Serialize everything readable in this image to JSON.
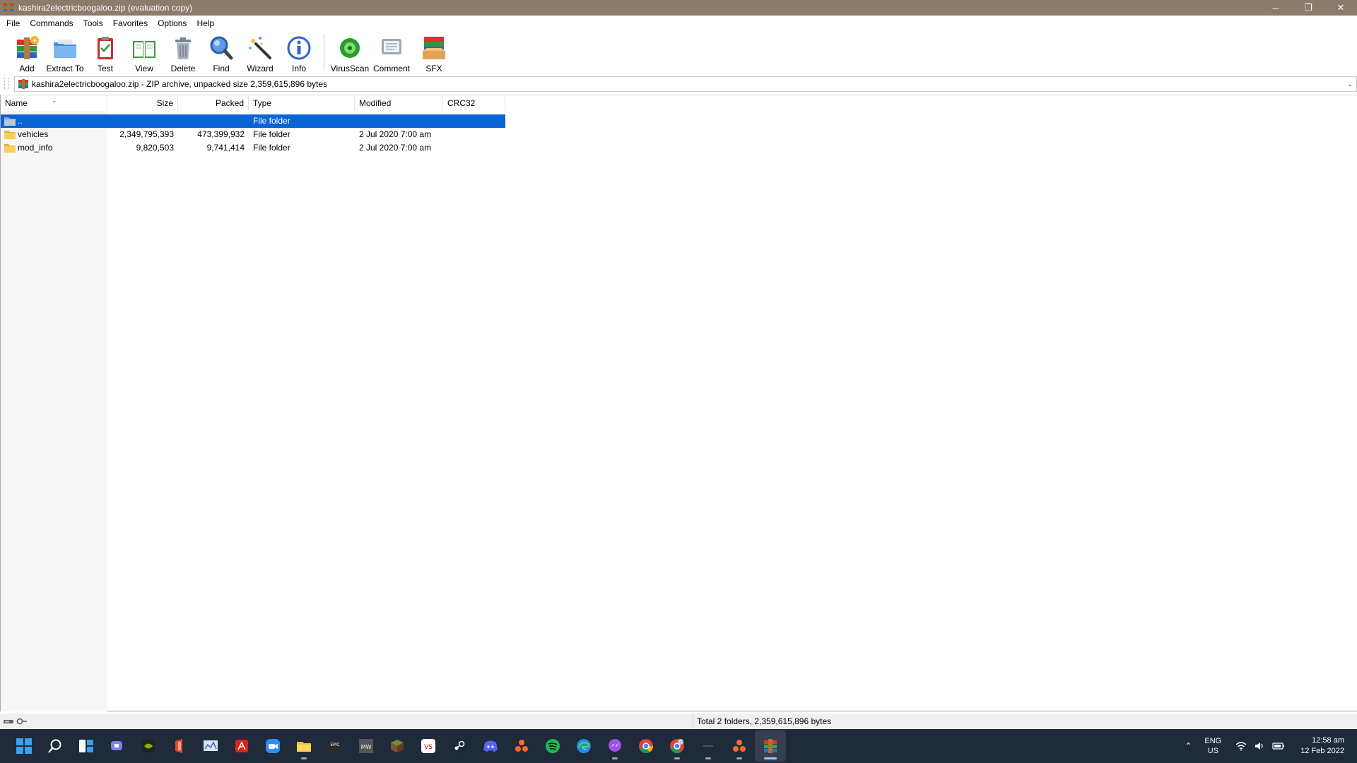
{
  "window": {
    "title": "kashira2electricboogaloo.zip (evaluation copy)",
    "minimize": "─",
    "restore": "❐",
    "close": "✕"
  },
  "menu": [
    "File",
    "Commands",
    "Tools",
    "Favorites",
    "Options",
    "Help"
  ],
  "toolbar": {
    "buttons": [
      {
        "label": "Add",
        "icon": "add-archive-icon"
      },
      {
        "label": "Extract To",
        "icon": "extract-folder-icon"
      },
      {
        "label": "Test",
        "icon": "test-clipboard-icon"
      },
      {
        "label": "View",
        "icon": "view-book-icon"
      },
      {
        "label": "Delete",
        "icon": "trash-icon"
      },
      {
        "label": "Find",
        "icon": "magnifier-icon"
      },
      {
        "label": "Wizard",
        "icon": "wizard-wand-icon"
      },
      {
        "label": "Info",
        "icon": "info-icon"
      },
      {
        "label": "VirusScan",
        "icon": "virus-scan-icon"
      },
      {
        "label": "Comment",
        "icon": "comment-icon"
      },
      {
        "label": "SFX",
        "icon": "sfx-box-icon"
      }
    ]
  },
  "address": {
    "text": "kashira2electricboogaloo.zip - ZIP archive, unpacked size 2,359,615,896 bytes"
  },
  "columns": {
    "name": "Name",
    "size": "Size",
    "packed": "Packed",
    "type": "Type",
    "modified": "Modified",
    "crc": "CRC32"
  },
  "rows": [
    {
      "name": "..",
      "size": "",
      "packed": "",
      "type": "File folder",
      "modified": "",
      "crc": "",
      "selected": true
    },
    {
      "name": "vehicles",
      "size": "2,349,795,393",
      "packed": "473,399,932",
      "type": "File folder",
      "modified": "2 Jul 2020 7:00 am",
      "crc": ""
    },
    {
      "name": "mod_info",
      "size": "9,820,503",
      "packed": "9,741,414",
      "type": "File folder",
      "modified": "2 Jul 2020 7:00 am",
      "crc": ""
    }
  ],
  "status": {
    "text": "Total 2 folders, 2,359,615,896 bytes"
  },
  "taskbar": {
    "apps": [
      "windows-start-icon",
      "search-icon",
      "widgets-icon",
      "teams-chat-icon",
      "nvidia-icon",
      "office-icon",
      "monitor-app-icon",
      "acrobat-icon",
      "zoom-icon",
      "file-explorer-icon",
      "epic-games-icon",
      "game-mw-icon",
      "minecraft-icon",
      "vs-app-icon",
      "steam-icon",
      "discord-icon",
      "origin-icon",
      "spotify-icon",
      "edge-icon",
      "messenger-icon",
      "chrome-icon",
      "chrome-profile-icon",
      "minimized-app-icon",
      "origin-alt-icon",
      "winrar-icon"
    ],
    "lang_top": "ENG",
    "lang_bottom": "US",
    "time": "12:58 am",
    "date": "12 Feb 2022",
    "colors": {
      "taskbar": "#1f2a3a",
      "selection": "#0a64d4",
      "titlebar": "#8a7b6a"
    }
  }
}
